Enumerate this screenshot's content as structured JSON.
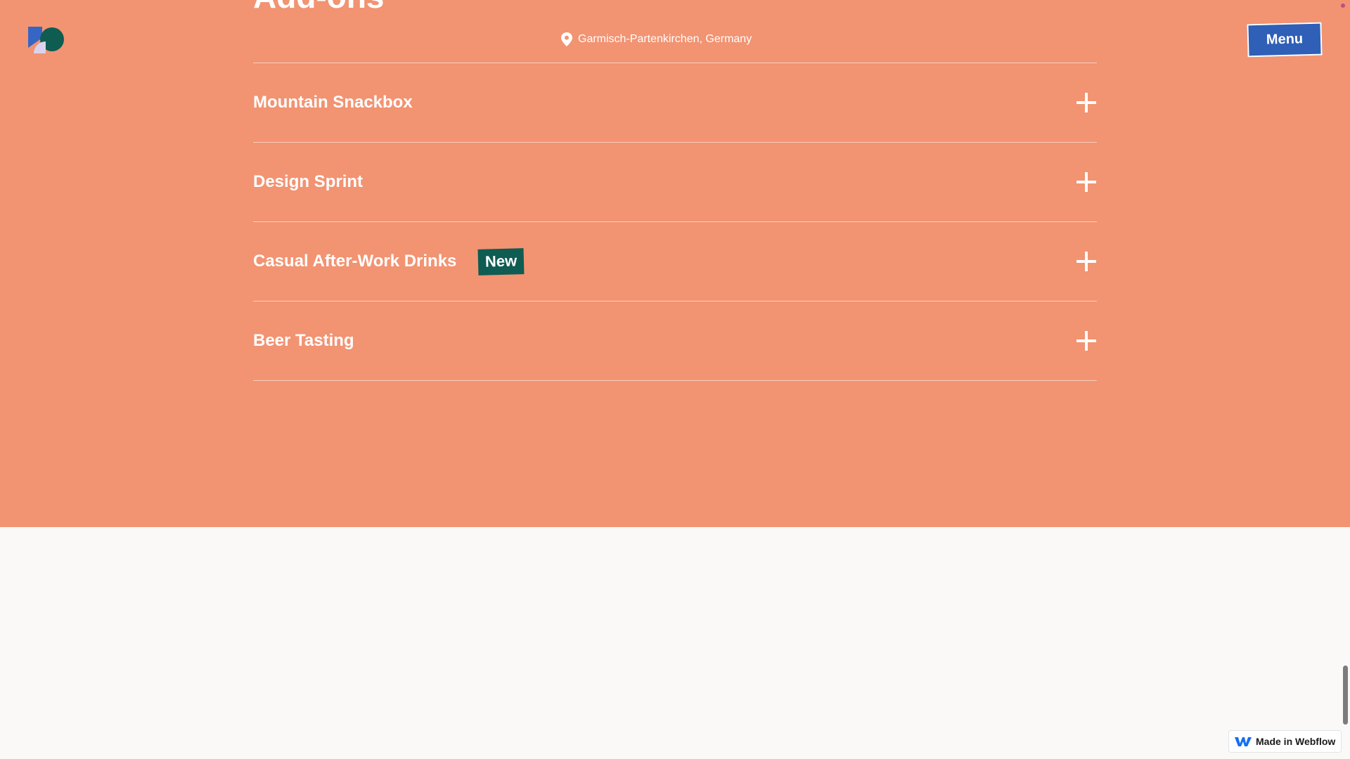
{
  "header": {
    "section_title": "Add-ons",
    "location": "Garmisch-Partenkirchen, Germany",
    "menu_label": "Menu",
    "logo_icon": "studio-logo-icon",
    "location_icon": "map-pin-icon"
  },
  "addons": [
    {
      "title": "Mountain Snackbox",
      "badge": "",
      "icon": "plus-icon"
    },
    {
      "title": "Design Sprint",
      "badge": "",
      "icon": "plus-icon"
    },
    {
      "title": "Casual After-Work Drinks",
      "badge": "New",
      "icon": "plus-icon"
    },
    {
      "title": "Beer Tasting",
      "badge": "",
      "icon": "plus-icon"
    }
  ],
  "webflow_badge": {
    "label": "Made in Webflow",
    "icon": "webflow-logo-icon"
  },
  "colors": {
    "hero_background": "#f29372",
    "menu_button": "#2f5fb7",
    "badge_background": "#0f5c52",
    "page_background": "#fbf9f8"
  }
}
